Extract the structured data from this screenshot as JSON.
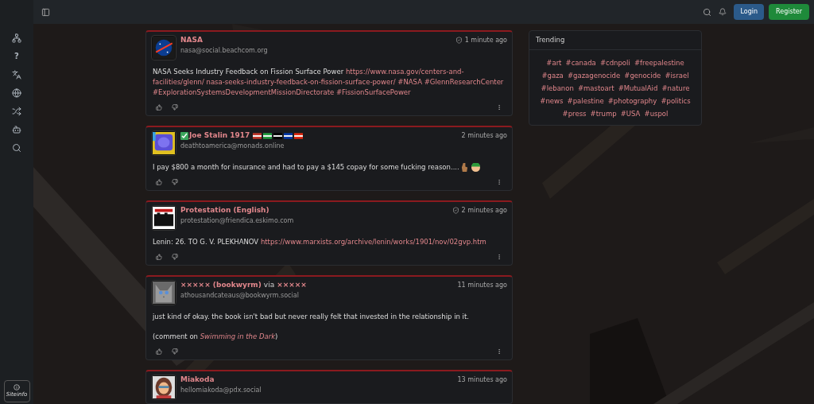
{
  "sidebar": {
    "items": [
      {
        "kind": "sitemap"
      },
      {
        "kind": "help",
        "glyph": "?"
      },
      {
        "kind": "translate"
      },
      {
        "kind": "globe"
      },
      {
        "kind": "shuffle"
      },
      {
        "kind": "bot"
      },
      {
        "kind": "search"
      }
    ],
    "siteinfo": "Siteinfo"
  },
  "topbar": {
    "login": "Login",
    "register": "Register"
  },
  "posts": [
    {
      "name": "NASA",
      "handle": "nasa@social.beachcom.org",
      "time": "1 minute ago",
      "shield": true,
      "paragraphs": [
        [
          {
            "kind": "text",
            "text": "NASA Seeks Industry Feedback on Fission Surface Power "
          },
          {
            "kind": "link",
            "text": "https://www.nasa.gov/centers-and-facilities/glenn/ nasa-seeks-industry-feedback-on-fission-surface-power/ #NASA #GlennResearchCenter #ExplorationSystemsDevelopmentMissionDirectorate #FissionSurfacePower"
          }
        ]
      ]
    },
    {
      "name": "Joe Stalin 1917",
      "verified": true,
      "flags": true,
      "handle": "deathtoamerica@monads.online",
      "time": "2 minutes ago",
      "shield": false,
      "paragraphs": [
        [
          {
            "kind": "text",
            "text": "I pay $800 a month for insurance and had to pay a $145 copay for some fucking reason.... "
          },
          {
            "kind": "emoji"
          }
        ]
      ]
    },
    {
      "name": "Protestation (English)",
      "handle": "protestation@friendica.eskimo.com",
      "time": "2 minutes ago",
      "shield": true,
      "paragraphs": [
        [
          {
            "kind": "text",
            "text": "Lenin: 26. TO G. V. PLEKHANOV "
          },
          {
            "kind": "link",
            "text": "https://www.marxists.org/archive/lenin/works/1901/nov/02gvp.htm"
          }
        ]
      ]
    },
    {
      "name": "××××× (bookwyrm)",
      "via": "via",
      "via_name": "×××××",
      "handle": "athousandcateaus@bookwyrm.social",
      "time": "11 minutes ago",
      "shield": false,
      "paragraphs": [
        [
          {
            "kind": "text",
            "text": "just kind of okay. the book isn't bad but never really felt that invested in the relationship in it."
          }
        ],
        [
          {
            "kind": "text",
            "text": "(comment on "
          },
          {
            "kind": "italic-link",
            "text": "Swimming in the Dark"
          },
          {
            "kind": "text",
            "text": ")"
          }
        ]
      ]
    },
    {
      "name": "Miakoda",
      "handle": "hellomiakoda@pdx.social",
      "time": "13 minutes ago",
      "shield": false
    }
  ],
  "trending": {
    "title": "Trending",
    "tags": [
      "#art",
      "#canada",
      "#cdnpoli",
      "#freepalestine",
      "#gaza",
      "#gazagenocide",
      "#genocide",
      "#israel",
      "#lebanon",
      "#mastoart",
      "#MutualAid",
      "#nature",
      "#news",
      "#palestine",
      "#photography",
      "#politics",
      "#press",
      "#trump",
      "#USA",
      "#uspol"
    ]
  }
}
